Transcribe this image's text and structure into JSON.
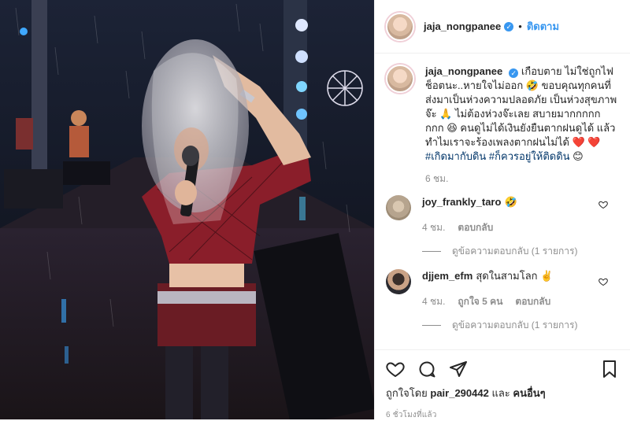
{
  "post": {
    "username": "jaja_nongpanee",
    "follow_label": "ติดตาม",
    "dot": "•"
  },
  "caption": {
    "username": "jaja_nongpanee",
    "text": "เกือบตาย ไม่ใช่ถูกไฟช็อตนะ..หายใจไม่ออก 🤣 ขอบคุณทุกคนที่ส่งมาเป็นห่วงความปลอดภัย เป็นห่วงสุขภาพจ๊ะ 🙏 ไม่ต้องห่วงจ๊ะเลย สบายมากกกกกกกก 😆 คนดูไม่ได้เงินยังยืนตากฝนดูได้ แล้วทำไมเราจะร้องเพลงตากฝนไม่ได้ ❤️ ❤️ ",
    "hashtags": "#เกิดมากับดิน #ก็ควรอยู่ให้ติดดิน",
    "emoji_end": " 😊",
    "time": "6 ชม."
  },
  "comments": [
    {
      "username": "joy_frankly_taro",
      "text": "🤣",
      "time": "4 ชม.",
      "likes": "",
      "reply_label": "ตอบกลับ",
      "view_replies": "ดูข้อความตอบกลับ (1 รายการ)"
    },
    {
      "username": "djjem_efm",
      "text": "สุดในสามโลก ✌️",
      "time": "4 ชม.",
      "likes": "ถูกใจ 5 คน",
      "reply_label": "ตอบกลับ",
      "view_replies": "ดูข้อความตอบกลับ (1 รายการ)"
    }
  ],
  "likes_line": {
    "prefix": "ถูกใจโดย",
    "user": "pair_290442",
    "middle": "และ",
    "others": "คนอื่นๆ"
  },
  "timestamp": "6 ชั่วโมงที่แล้ว",
  "icons": {
    "like": "heart-icon",
    "comment": "comment-icon",
    "share": "share-icon",
    "save": "bookmark-icon"
  },
  "colors": {
    "link": "#3897f0",
    "verified": "#3897f0",
    "text": "#262626",
    "muted": "#8e8e8e",
    "heart": "#ed4956"
  }
}
